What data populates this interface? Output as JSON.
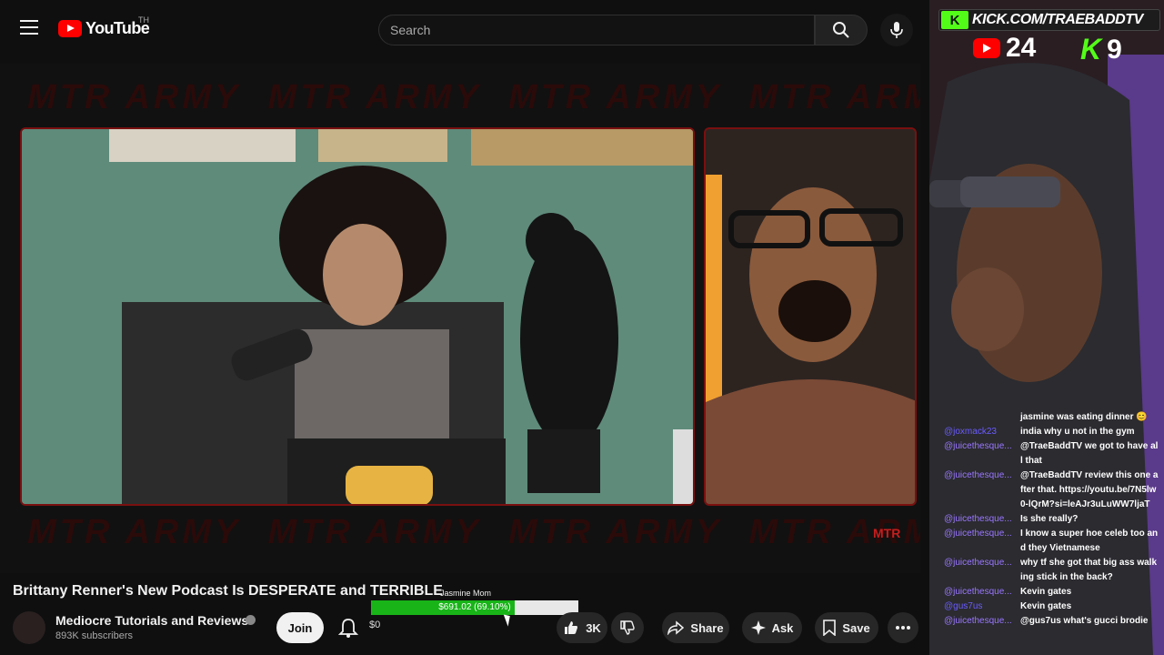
{
  "youtube": {
    "logo_text": "YouTube",
    "logo_country": "TH",
    "search_placeholder": "Search",
    "banner_text": "MTR ARMY",
    "watermark": "MTR",
    "video": {
      "title": "Brittany Renner's New Podcast Is DESPERATE and TERRIBLE",
      "channel": "Mediocre Tutorials and Reviews",
      "subscribers": "893K subscribers",
      "join_label": "Join",
      "likes": "3K",
      "share_label": "Share",
      "ask_label": "Ask",
      "save_label": "Save",
      "donation_zero": "$0"
    },
    "goal": {
      "label": "Jasmine Mom",
      "text": "$691.02 (69.10%)",
      "fraction": 0.691,
      "fill_color": "#18b418"
    }
  },
  "stream": {
    "kick_logo": "K",
    "kick_url": "KICK.COM/TRAEBADDTV",
    "youtube_viewers": "24",
    "kick_badge": "K",
    "kick_viewers": "9",
    "accent_color": "#53fc18",
    "chat": [
      {
        "user": "",
        "text": "jasmine was eating dinner 😊"
      },
      {
        "user": "@joxmack23",
        "text": "india why u not in the gym"
      },
      {
        "user": "@juicethesque...",
        "text": "@TraeBaddTV we got to have all that"
      },
      {
        "user": "@juicethesque...",
        "text": "@TraeBaddTV review this one after that. https://youtu.be/7N5lw0-lQrM?si=leAJr3uLuWW7ljaT"
      },
      {
        "user": "@juicethesque...",
        "text": "Is she really?"
      },
      {
        "user": "@juicethesque...",
        "text": "I know a super hoe celeb too and they Vietnamese"
      },
      {
        "user": "@juicethesque...",
        "text": "why tf she got that big ass walking stick in the back?"
      },
      {
        "user": "@juicethesque...",
        "text": "Kevin gates"
      },
      {
        "user": "@gus7us",
        "text": "Kevin gates"
      },
      {
        "user": "@juicethesque...",
        "text": "@gus7us what's gucci brodie"
      }
    ]
  }
}
